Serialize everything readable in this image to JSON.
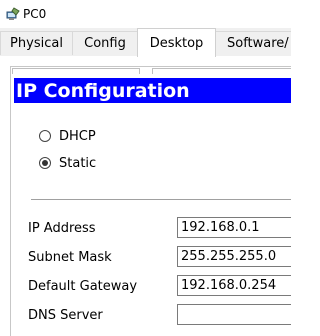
{
  "window": {
    "title": "PC0",
    "icon": "pc-workstation-icon"
  },
  "tabs": [
    {
      "label": "Physical",
      "active": false
    },
    {
      "label": "Config",
      "active": false
    },
    {
      "label": "Desktop",
      "active": true
    },
    {
      "label": "Software/",
      "active": false
    }
  ],
  "panel": {
    "title": "IP Configuration",
    "header_color": "#0000ff"
  },
  "mode": {
    "options": [
      {
        "label": "DHCP",
        "checked": false
      },
      {
        "label": "Static",
        "checked": true
      }
    ]
  },
  "fields": [
    {
      "label": "IP Address",
      "value": "192.168.0.1"
    },
    {
      "label": "Subnet Mask",
      "value": "255.255.255.0"
    },
    {
      "label": "Default Gateway",
      "value": "192.168.0.254"
    },
    {
      "label": "DNS Server",
      "value": ""
    }
  ]
}
